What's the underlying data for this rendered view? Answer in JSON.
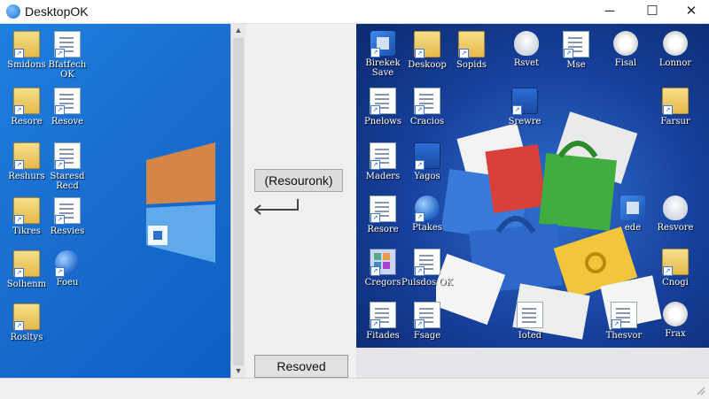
{
  "window": {
    "title": "DesktopOK",
    "minimize_glyph": "─",
    "maximize_glyph": "☐",
    "close_glyph": "✕"
  },
  "left_icons": [
    {
      "label": "Smidons",
      "icon": "folder-icon"
    },
    {
      "label": "Bfatfech OK",
      "icon": "doc-icon"
    },
    {
      "label": "Resore",
      "icon": "folder-icon"
    },
    {
      "label": "Resove",
      "icon": "doc-icon"
    },
    {
      "label": "Reshurs",
      "icon": "folder-icon"
    },
    {
      "label": "Staresd Recd",
      "icon": "doc-icon"
    },
    {
      "label": "Tikres",
      "icon": "folder-icon"
    },
    {
      "label": "Resvies",
      "icon": "doc-icon"
    },
    {
      "label": "Solhenm",
      "icon": "folder-icon"
    },
    {
      "label": "Foeu",
      "icon": "globe-icon"
    },
    {
      "label": "Rosltys",
      "icon": "folder-icon"
    }
  ],
  "right_icons": [
    {
      "label": "Birekek Save",
      "icon": "app-icon"
    },
    {
      "label": "Deskoop",
      "icon": "folder-icon"
    },
    {
      "label": "Sopids",
      "icon": "folder-icon"
    },
    {
      "label": "Rsvet",
      "icon": "mouse-icon"
    },
    {
      "label": "Mse",
      "icon": "doc-icon"
    },
    {
      "label": "Fisal",
      "icon": "gear-icon"
    },
    {
      "label": "Lonnor",
      "icon": "gear-icon"
    },
    {
      "label": "Pnelows",
      "icon": "doc-icon"
    },
    {
      "label": "Cracios",
      "icon": "doc-icon"
    },
    {
      "label": "Srewre",
      "icon": "box-icon"
    },
    {
      "label": "Farsur",
      "icon": "folder-icon"
    },
    {
      "label": "Maders",
      "icon": "doc-icon"
    },
    {
      "label": "Yagos",
      "icon": "box-icon"
    },
    {
      "label": "Resore",
      "icon": "doc-icon"
    },
    {
      "label": "Ptakes",
      "icon": "globe-icon"
    },
    {
      "label": "ede",
      "icon": "app-icon"
    },
    {
      "label": "Resvore",
      "icon": "mouse-icon"
    },
    {
      "label": "Cregors",
      "icon": "grid-icon"
    },
    {
      "label": "Pulsdos OK",
      "icon": "doc-icon"
    },
    {
      "label": "Cnogi",
      "icon": "folder-icon"
    },
    {
      "label": "Fitades",
      "icon": "doc-icon"
    },
    {
      "label": "Fsage",
      "icon": "doc-icon"
    },
    {
      "label": "Ioted",
      "icon": "doc-icon"
    },
    {
      "label": "Thesvor",
      "icon": "doc-icon"
    },
    {
      "label": "Frax",
      "icon": "gear-icon"
    }
  ],
  "tooltip": {
    "text": "(Resouronk)"
  },
  "resolved_button": {
    "label": "Resoved"
  },
  "scroll": {
    "up_glyph": "▲",
    "down_glyph": "▼"
  },
  "colors": {
    "left_bg": "#1a6fd0",
    "right_bg": "#163f9a",
    "button_bg": "#e1e1e1"
  }
}
